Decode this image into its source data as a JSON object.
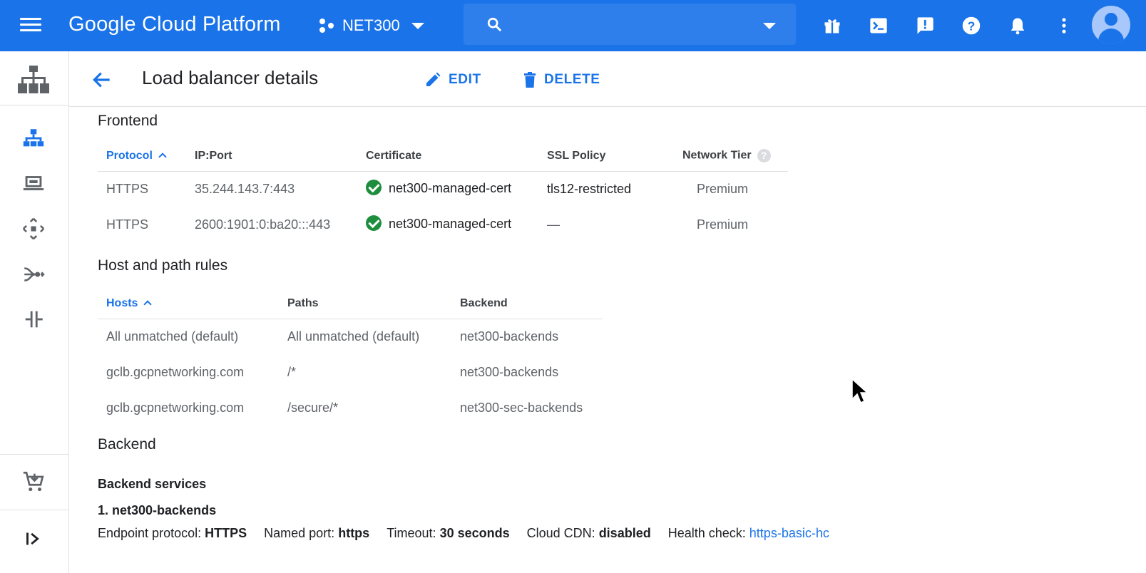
{
  "app": {
    "brand": "Google Cloud Platform",
    "project": "NET300"
  },
  "search": {
    "placeholder": ""
  },
  "page": {
    "title": "Load balancer details",
    "edit_label": "EDIT",
    "delete_label": "DELETE"
  },
  "frontend": {
    "title": "Frontend",
    "columns": [
      "Protocol",
      "IP:Port",
      "Certificate",
      "SSL Policy",
      "Network Tier"
    ],
    "rows": [
      {
        "protocol": "HTTPS",
        "ip_port": "35.244.143.7:443",
        "certificate": "net300-managed-cert",
        "ssl_policy": "tls12-restricted",
        "tier": "Premium"
      },
      {
        "protocol": "HTTPS",
        "ip_port": "2600:1901:0:ba20:::443",
        "certificate": "net300-managed-cert",
        "ssl_policy": "—",
        "tier": "Premium"
      }
    ]
  },
  "host_rules": {
    "title": "Host and path rules",
    "columns": [
      "Hosts",
      "Paths",
      "Backend"
    ],
    "rows": [
      {
        "host": "All unmatched (default)",
        "path": "All unmatched (default)",
        "backend": "net300-backends"
      },
      {
        "host": "gclb.gcpnetworking.com",
        "path": "/*",
        "backend": "net300-backends"
      },
      {
        "host": "gclb.gcpnetworking.com",
        "path": "/secure/*",
        "backend": "net300-sec-backends"
      }
    ]
  },
  "backend": {
    "title": "Backend",
    "services_title": "Backend services",
    "service_name": "1. net300-backends",
    "props": {
      "endpoint_label": "Endpoint protocol:",
      "endpoint_value": "HTTPS",
      "port_label": "Named port:",
      "port_value": "https",
      "timeout_label": "Timeout:",
      "timeout_value": "30 seconds",
      "cdn_label": "Cloud CDN:",
      "cdn_value": "disabled",
      "health_label": "Health check:",
      "health_value": "https-basic-hc"
    }
  },
  "colors": {
    "topbar": "#1a73e8",
    "accent": "#1a73e8",
    "success": "#1e8e3e"
  }
}
